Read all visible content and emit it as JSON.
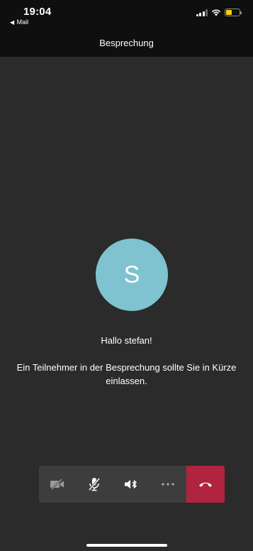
{
  "status_bar": {
    "time": "19:04",
    "back_app": "Mail"
  },
  "nav": {
    "title": "Besprechung"
  },
  "lobby": {
    "avatar_initial": "S",
    "avatar_color": "#7ec3cf",
    "greeting": "Hallo stefan!",
    "message": "Ein Teilnehmer in der Besprechung sollte Sie in Kürze einlassen."
  },
  "controls": [
    {
      "name": "camera-off-button",
      "icon": "video-off-icon"
    },
    {
      "name": "mute-button",
      "icon": "mic-off-icon"
    },
    {
      "name": "speaker-button",
      "icon": "speaker-bluetooth-icon"
    },
    {
      "name": "more-options-button",
      "icon": "ellipsis-icon"
    },
    {
      "name": "hang-up-button",
      "icon": "phone-hangup-icon",
      "color": "#b0243f"
    }
  ]
}
